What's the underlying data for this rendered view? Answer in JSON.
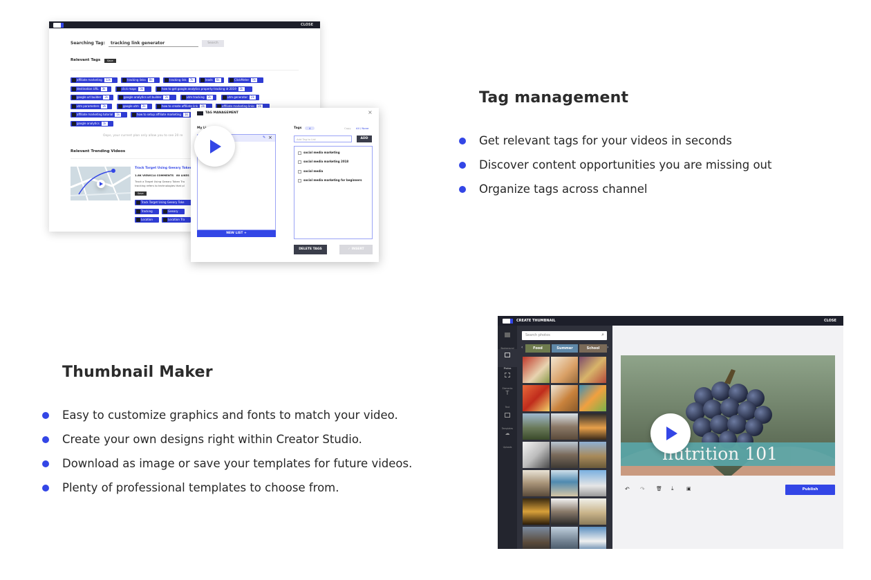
{
  "tag_section": {
    "title": "Tag management",
    "bullets": [
      "Get relevant tags for your videos in seconds",
      "Discover content opportunities you are missing out",
      "Organize tags across channel"
    ]
  },
  "thumb_section": {
    "title": "Thumbnail Maker",
    "bullets": [
      "Easy to customize graphics and fonts to match your video.",
      "Create your own designs right within Creator Studio.",
      "Download as image or save your templates for future videos.",
      "Plenty of professional templates to choose from."
    ]
  },
  "tag_shot": {
    "close": "CLOSE",
    "search_label": "Searching Tag:",
    "search_value": "tracking link generator",
    "search_button": "Search",
    "relevant_tags": "Relevant Tags",
    "relevant_badge": "Save",
    "tags": [
      {
        "label": "affiliate marketing",
        "n": "12k"
      },
      {
        "label": "tracking links",
        "n": "8k"
      },
      {
        "label": "tracking link",
        "n": "7k"
      },
      {
        "label": "leads",
        "n": "6k"
      },
      {
        "label": "ClickMeter",
        "n": "5k"
      },
      {
        "label": "destination URL",
        "n": "3k"
      },
      {
        "label": "click maps",
        "n": "3k"
      },
      {
        "label": "how to get google analytics property tracking id 2019",
        "n": "3k"
      },
      {
        "label": "google url builder",
        "n": "2k"
      },
      {
        "label": "google analytics url builder",
        "n": "2k"
      },
      {
        "label": "utm tracking",
        "n": "2k"
      },
      {
        "label": "utm generator",
        "n": "2k"
      },
      {
        "label": "utm parameters",
        "n": "2k"
      },
      {
        "label": "google utm",
        "n": "2k"
      },
      {
        "label": "how to create affiliate link",
        "n": "2k"
      },
      {
        "label": "affiliate marketing links",
        "n": "2k"
      },
      {
        "label": "affiliate marketing tutorial",
        "n": "1k"
      },
      {
        "label": "how to setup affiliate marketing",
        "n": "1k"
      },
      {
        "label": "google analytics",
        "n": "1k"
      }
    ],
    "plan_note": "Oops, your current plan only allow you to see 20 re",
    "trending_title": "Relevant Trending Videos",
    "video_title": "Track Target Using Geeary Token",
    "video_stats": [
      "1.8K VIEWS",
      "14 COMMENTS",
      "80 LIKES"
    ],
    "video_desc": "Track a Target Using Geeary Token Tra tracking refers to technologies that pl",
    "video_button": "Save",
    "video_tags": [
      "Track Target Using Geeary Toke",
      "Tracking",
      "Geeary",
      "Location",
      "Location Tra"
    ]
  },
  "tag_modal": {
    "title": "TAG MANAGEMENT",
    "my_lists": "My Li",
    "tags_label": "Tags",
    "tags_count": "4",
    "copy": "Copy",
    "all_none": "All / None",
    "add_placeholder": "Add Tag to List",
    "add_button": "ADD",
    "list_tags": [
      "social media marketing",
      "social media marketing 2018",
      "social media",
      "social media marketing for beginners"
    ],
    "new_list": "NEW LIST",
    "delete_tags": "DELETE TAGS",
    "insert": "INSERT"
  },
  "thumb_shot": {
    "header": "CREATE THUMBNAIL",
    "close": "CLOSE",
    "side_items": [
      "Background",
      "Photos",
      "Elements",
      "Text",
      "Templates",
      "Uploads"
    ],
    "search_placeholder": "Search photos",
    "categories": [
      "Food",
      "Summer",
      "School"
    ],
    "canvas_text": "nutrition 101",
    "publish": "Publish"
  },
  "colors": {
    "accent": "#3346e6",
    "dark": "#1d1f2a",
    "banner": "#5aa6a8"
  },
  "icons": [
    "play-icon",
    "search-icon",
    "close-icon",
    "undo-icon",
    "redo-icon",
    "delete-icon",
    "download-icon",
    "save-icon"
  ]
}
